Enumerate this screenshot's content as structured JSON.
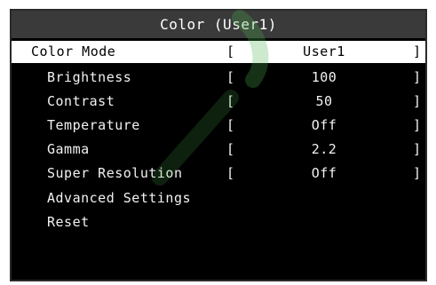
{
  "window": {
    "title": "Color (User1)"
  },
  "menu": {
    "items": [
      {
        "label": "Color Mode",
        "value": "User1",
        "selected": true,
        "bracketed": true
      },
      {
        "label": "Brightness",
        "value": "100",
        "selected": false,
        "bracketed": true
      },
      {
        "label": "Contrast",
        "value": "50",
        "selected": false,
        "bracketed": true
      },
      {
        "label": "Temperature",
        "value": "Off",
        "selected": false,
        "bracketed": true
      },
      {
        "label": "Gamma",
        "value": "2.2",
        "selected": false,
        "bracketed": true
      },
      {
        "label": "Super Resolution",
        "value": "Off",
        "selected": false,
        "bracketed": true
      },
      {
        "label": "Advanced Settings",
        "value": "",
        "selected": false,
        "bracketed": false
      },
      {
        "label": "Reset",
        "value": "",
        "selected": false,
        "bracketed": false
      }
    ]
  },
  "brackets": {
    "open": "[",
    "close": "]"
  },
  "colors": {
    "background": "#000000",
    "title_bar": "#3a3a3a",
    "selected_row": "#ffffff",
    "text": "#f2f2f2",
    "watermark": "#4caf50"
  }
}
